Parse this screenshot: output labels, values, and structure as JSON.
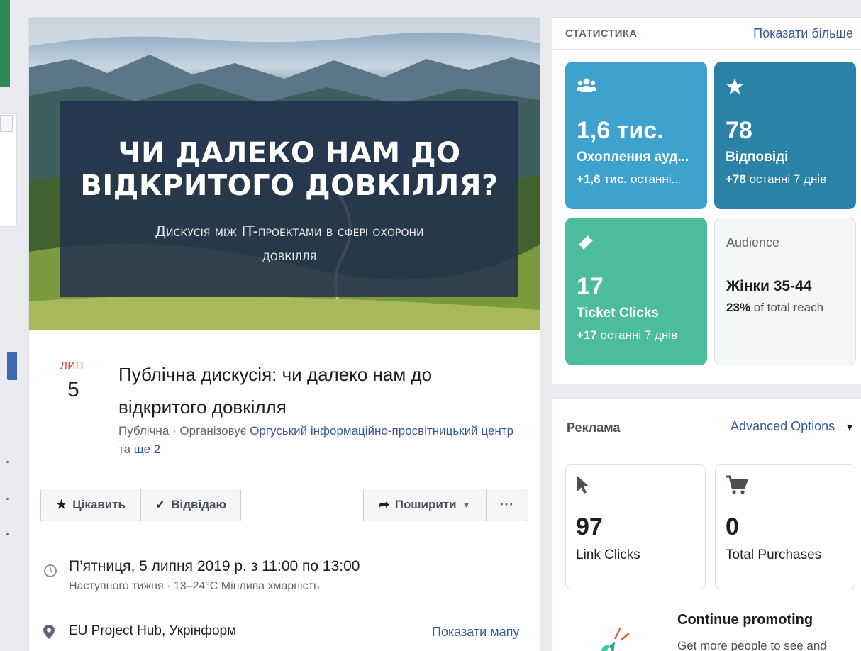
{
  "event": {
    "cover": {
      "title": "Чи далеко нам до відкритого довкілля?",
      "subtitle": "Дискусія між IT-проектами в сфері охорони довкілля"
    },
    "date_month": "ЛИП",
    "date_day": "5",
    "title": "Публічна дискусія: чи далеко нам до відкритого довкілля",
    "meta": {
      "privacy": "Публічна",
      "sep": " · ",
      "organizer_prefix": "Організовує ",
      "organizer": "Оргуський інформаційно-просвітницький центр",
      "and": " та ",
      "more": "ще 2"
    },
    "buttons": {
      "interested": "Цікавить",
      "going": "Відвідаю",
      "share": "Поширити",
      "more": "···"
    },
    "icons": {
      "interested": "star-icon",
      "going": "check-icon",
      "share": "share-arrow-icon",
      "share_caret": "caret-down-icon",
      "time": "clock-icon",
      "location": "map-pin-icon"
    },
    "time_main": "П’ятниця, 5 липня 2019 р. з 11:00 по 13:00",
    "time_sub": "Наступного тижня · 13–24°C Мінлива хмарність",
    "location_main": "EU Project Hub, Укрінформ",
    "location_map_link": "Показати мапу"
  },
  "stats": {
    "header": "СТАТИСТИКА",
    "show_more": "Показати більше",
    "reach": {
      "icon": "people-icon",
      "value": "1,6 тис.",
      "label": "Охоплення ауд...",
      "delta": "+1,6 тис.",
      "delta_text": " останні..."
    },
    "responses": {
      "icon": "star-icon",
      "value": "78",
      "label": "Відповіді",
      "delta": "+78",
      "delta_text": " останні 7 днів"
    },
    "tickets": {
      "icon": "ticket-icon",
      "value": "17",
      "label": "Ticket Clicks",
      "delta": "+17",
      "delta_text": " останні 7 днів"
    },
    "audience": {
      "label": "Audience",
      "value": "Жінки 35-44",
      "pct": "23%",
      "pct_text": " of total reach"
    },
    "colors": {
      "reach": "#3ea2cf",
      "responses": "#2a83a6",
      "tickets": "#4bbd9c"
    }
  },
  "ads": {
    "header": "Реклама",
    "advanced": "Advanced Options",
    "link_clicks": {
      "icon": "cursor-icon",
      "value": "97",
      "label": "Link Clicks"
    },
    "purchases": {
      "icon": "cart-icon",
      "value": "0",
      "label": "Total Purchases"
    },
    "promo_title": "Continue promoting",
    "promo_text": "Get more people to see and",
    "promo_icon": "megaphone-icon"
  }
}
